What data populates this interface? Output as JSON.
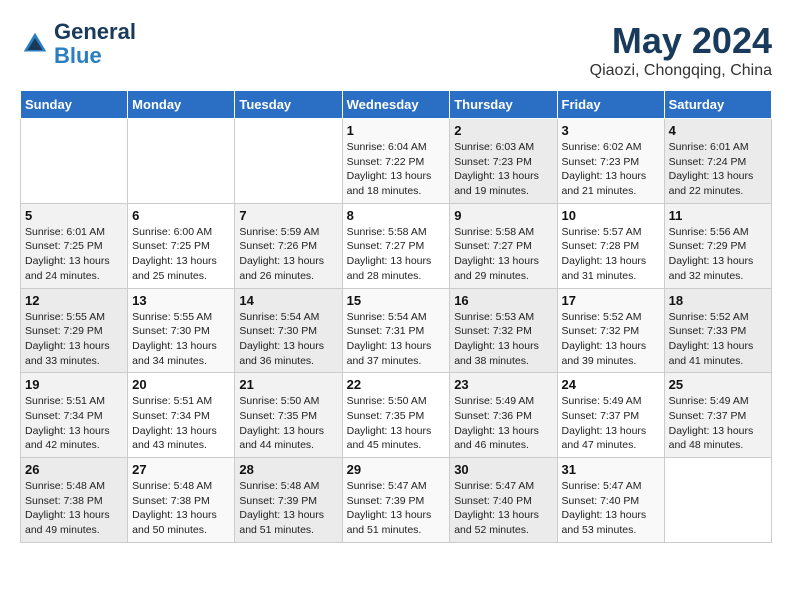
{
  "header": {
    "logo_line1": "General",
    "logo_line2": "Blue",
    "month_year": "May 2024",
    "location": "Qiaozi, Chongqing, China"
  },
  "weekdays": [
    "Sunday",
    "Monday",
    "Tuesday",
    "Wednesday",
    "Thursday",
    "Friday",
    "Saturday"
  ],
  "weeks": [
    [
      {
        "day": "",
        "info": ""
      },
      {
        "day": "",
        "info": ""
      },
      {
        "day": "",
        "info": ""
      },
      {
        "day": "1",
        "info": "Sunrise: 6:04 AM\nSunset: 7:22 PM\nDaylight: 13 hours\nand 18 minutes."
      },
      {
        "day": "2",
        "info": "Sunrise: 6:03 AM\nSunset: 7:23 PM\nDaylight: 13 hours\nand 19 minutes."
      },
      {
        "day": "3",
        "info": "Sunrise: 6:02 AM\nSunset: 7:23 PM\nDaylight: 13 hours\nand 21 minutes."
      },
      {
        "day": "4",
        "info": "Sunrise: 6:01 AM\nSunset: 7:24 PM\nDaylight: 13 hours\nand 22 minutes."
      }
    ],
    [
      {
        "day": "5",
        "info": "Sunrise: 6:01 AM\nSunset: 7:25 PM\nDaylight: 13 hours\nand 24 minutes."
      },
      {
        "day": "6",
        "info": "Sunrise: 6:00 AM\nSunset: 7:25 PM\nDaylight: 13 hours\nand 25 minutes."
      },
      {
        "day": "7",
        "info": "Sunrise: 5:59 AM\nSunset: 7:26 PM\nDaylight: 13 hours\nand 26 minutes."
      },
      {
        "day": "8",
        "info": "Sunrise: 5:58 AM\nSunset: 7:27 PM\nDaylight: 13 hours\nand 28 minutes."
      },
      {
        "day": "9",
        "info": "Sunrise: 5:58 AM\nSunset: 7:27 PM\nDaylight: 13 hours\nand 29 minutes."
      },
      {
        "day": "10",
        "info": "Sunrise: 5:57 AM\nSunset: 7:28 PM\nDaylight: 13 hours\nand 31 minutes."
      },
      {
        "day": "11",
        "info": "Sunrise: 5:56 AM\nSunset: 7:29 PM\nDaylight: 13 hours\nand 32 minutes."
      }
    ],
    [
      {
        "day": "12",
        "info": "Sunrise: 5:55 AM\nSunset: 7:29 PM\nDaylight: 13 hours\nand 33 minutes."
      },
      {
        "day": "13",
        "info": "Sunrise: 5:55 AM\nSunset: 7:30 PM\nDaylight: 13 hours\nand 34 minutes."
      },
      {
        "day": "14",
        "info": "Sunrise: 5:54 AM\nSunset: 7:30 PM\nDaylight: 13 hours\nand 36 minutes."
      },
      {
        "day": "15",
        "info": "Sunrise: 5:54 AM\nSunset: 7:31 PM\nDaylight: 13 hours\nand 37 minutes."
      },
      {
        "day": "16",
        "info": "Sunrise: 5:53 AM\nSunset: 7:32 PM\nDaylight: 13 hours\nand 38 minutes."
      },
      {
        "day": "17",
        "info": "Sunrise: 5:52 AM\nSunset: 7:32 PM\nDaylight: 13 hours\nand 39 minutes."
      },
      {
        "day": "18",
        "info": "Sunrise: 5:52 AM\nSunset: 7:33 PM\nDaylight: 13 hours\nand 41 minutes."
      }
    ],
    [
      {
        "day": "19",
        "info": "Sunrise: 5:51 AM\nSunset: 7:34 PM\nDaylight: 13 hours\nand 42 minutes."
      },
      {
        "day": "20",
        "info": "Sunrise: 5:51 AM\nSunset: 7:34 PM\nDaylight: 13 hours\nand 43 minutes."
      },
      {
        "day": "21",
        "info": "Sunrise: 5:50 AM\nSunset: 7:35 PM\nDaylight: 13 hours\nand 44 minutes."
      },
      {
        "day": "22",
        "info": "Sunrise: 5:50 AM\nSunset: 7:35 PM\nDaylight: 13 hours\nand 45 minutes."
      },
      {
        "day": "23",
        "info": "Sunrise: 5:49 AM\nSunset: 7:36 PM\nDaylight: 13 hours\nand 46 minutes."
      },
      {
        "day": "24",
        "info": "Sunrise: 5:49 AM\nSunset: 7:37 PM\nDaylight: 13 hours\nand 47 minutes."
      },
      {
        "day": "25",
        "info": "Sunrise: 5:49 AM\nSunset: 7:37 PM\nDaylight: 13 hours\nand 48 minutes."
      }
    ],
    [
      {
        "day": "26",
        "info": "Sunrise: 5:48 AM\nSunset: 7:38 PM\nDaylight: 13 hours\nand 49 minutes."
      },
      {
        "day": "27",
        "info": "Sunrise: 5:48 AM\nSunset: 7:38 PM\nDaylight: 13 hours\nand 50 minutes."
      },
      {
        "day": "28",
        "info": "Sunrise: 5:48 AM\nSunset: 7:39 PM\nDaylight: 13 hours\nand 51 minutes."
      },
      {
        "day": "29",
        "info": "Sunrise: 5:47 AM\nSunset: 7:39 PM\nDaylight: 13 hours\nand 51 minutes."
      },
      {
        "day": "30",
        "info": "Sunrise: 5:47 AM\nSunset: 7:40 PM\nDaylight: 13 hours\nand 52 minutes."
      },
      {
        "day": "31",
        "info": "Sunrise: 5:47 AM\nSunset: 7:40 PM\nDaylight: 13 hours\nand 53 minutes."
      },
      {
        "day": "",
        "info": ""
      }
    ]
  ]
}
